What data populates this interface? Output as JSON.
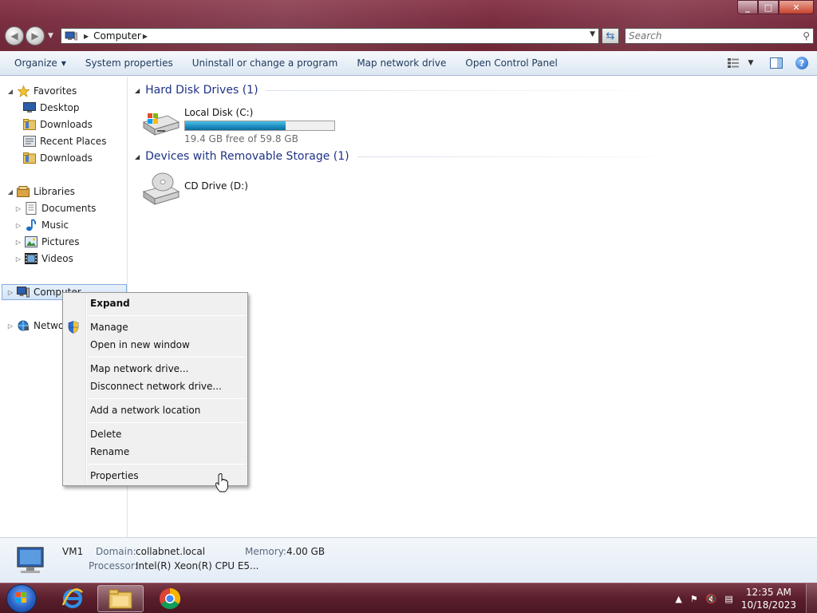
{
  "window": {
    "minimize_glyph": "_",
    "maximize_glyph": "□",
    "close_glyph": "✕"
  },
  "address": {
    "crumbs": [
      "Computer"
    ],
    "search_placeholder": "Search"
  },
  "commandbar": {
    "items": [
      {
        "label": "Organize",
        "has_dropdown": true
      },
      {
        "label": "System properties"
      },
      {
        "label": "Uninstall or change a program"
      },
      {
        "label": "Map network drive"
      },
      {
        "label": "Open Control Panel"
      }
    ]
  },
  "navpane": {
    "favorites": {
      "label": "Favorites",
      "items": [
        "Desktop",
        "Downloads",
        "Recent Places",
        "Downloads"
      ]
    },
    "libraries": {
      "label": "Libraries",
      "items": [
        "Documents",
        "Music",
        "Pictures",
        "Videos"
      ]
    },
    "computer": {
      "label": "Computer"
    },
    "network": {
      "label": "Network"
    }
  },
  "content": {
    "groups": [
      {
        "title": "Hard Disk Drives (1)",
        "drives": [
          {
            "name": "Local Disk (C:)",
            "free_text": "19.4 GB free of 59.8 GB",
            "used_fraction": 0.676
          }
        ]
      },
      {
        "title": "Devices with Removable Storage (1)",
        "drives": [
          {
            "name": "CD Drive (D:)"
          }
        ]
      }
    ]
  },
  "context_menu": {
    "items": [
      "Expand",
      "Manage",
      "Open in new window",
      "Map network drive...",
      "Disconnect network drive...",
      "Add a network location",
      "Delete",
      "Rename",
      "Properties"
    ]
  },
  "details": {
    "name": "VM1",
    "domain_label": "Domain:",
    "domain_value": "collabnet.local",
    "memory_label": "Memory:",
    "memory_value": "4.00 GB",
    "processor_label": "Processor:",
    "processor_value": "Intel(R) Xeon(R) CPU E5..."
  },
  "taskbar": {
    "time": "12:35 AM",
    "date": "10/18/2023"
  },
  "colors": {
    "titlebar": "#7a2e40",
    "group_header": "#1e3287",
    "drive_bar": "#1b8bbf"
  }
}
